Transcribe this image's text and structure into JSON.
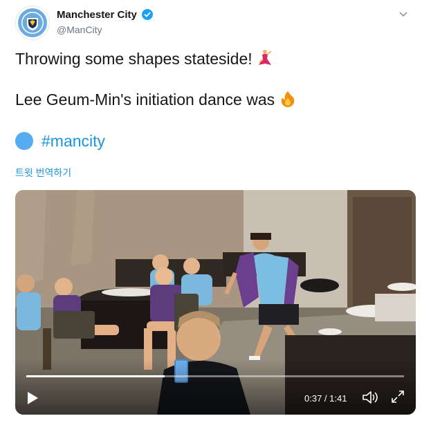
{
  "author": {
    "display_name": "Manchester City",
    "handle": "@ManCity",
    "crest_text_top": "MANCHESTER",
    "crest_text_bottom": "CITY"
  },
  "tweet": {
    "line1": "Throwing some shapes stateside!",
    "line2": "Lee Geum-Min's initiation dance was",
    "hashtag": "#mancity",
    "translate": "트윗 번역하기"
  },
  "video": {
    "time": "0:37 / 1:41",
    "progress": 0.366
  },
  "colors": {
    "link": "#1b95e0",
    "verified": "#1da1f2",
    "text": "#14171a",
    "muted": "#657786"
  },
  "icons": [
    "verified-icon",
    "caret-down-icon",
    "dancer-emoji-icon",
    "fire-emoji-icon",
    "blue-circle-icon",
    "play-icon",
    "volume-icon",
    "fullscreen-icon"
  ]
}
